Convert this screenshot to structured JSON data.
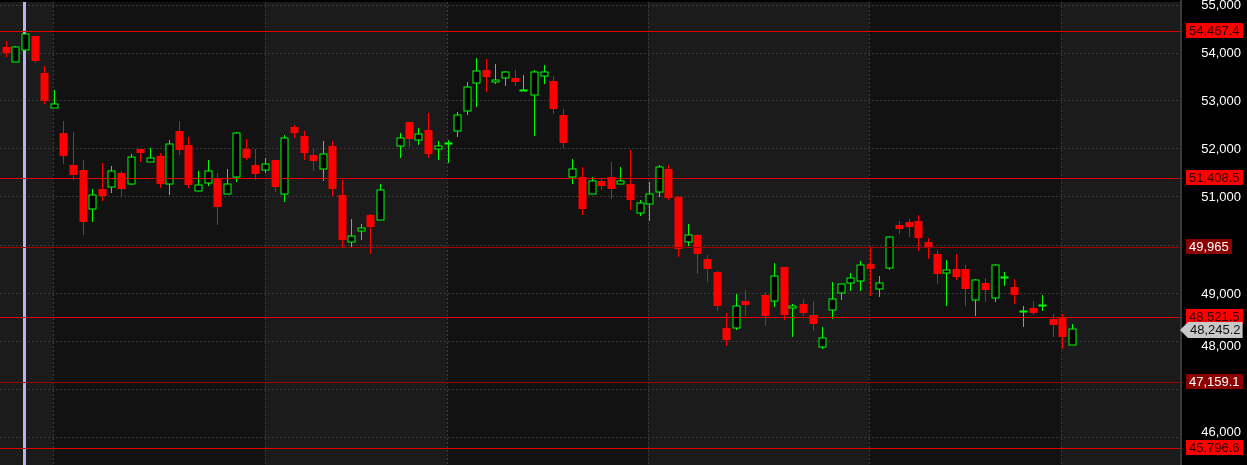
{
  "price_axis": {
    "ticks": [
      "55,000",
      "54,000",
      "53,000",
      "52,000",
      "51,000",
      "49,000",
      "48,000",
      "46,000"
    ]
  },
  "price_lines": [
    {
      "label": "54,467.4",
      "kind": "bright"
    },
    {
      "label": "51,408.5",
      "kind": "bright"
    },
    {
      "label": "49,965",
      "kind": "dark"
    },
    {
      "label": "48,521.5",
      "kind": "bright"
    },
    {
      "label": "47,159.1",
      "kind": "dark"
    },
    {
      "label": "45,796.6",
      "kind": "bright"
    }
  ],
  "current_price": {
    "label": "48,245.2"
  }
}
